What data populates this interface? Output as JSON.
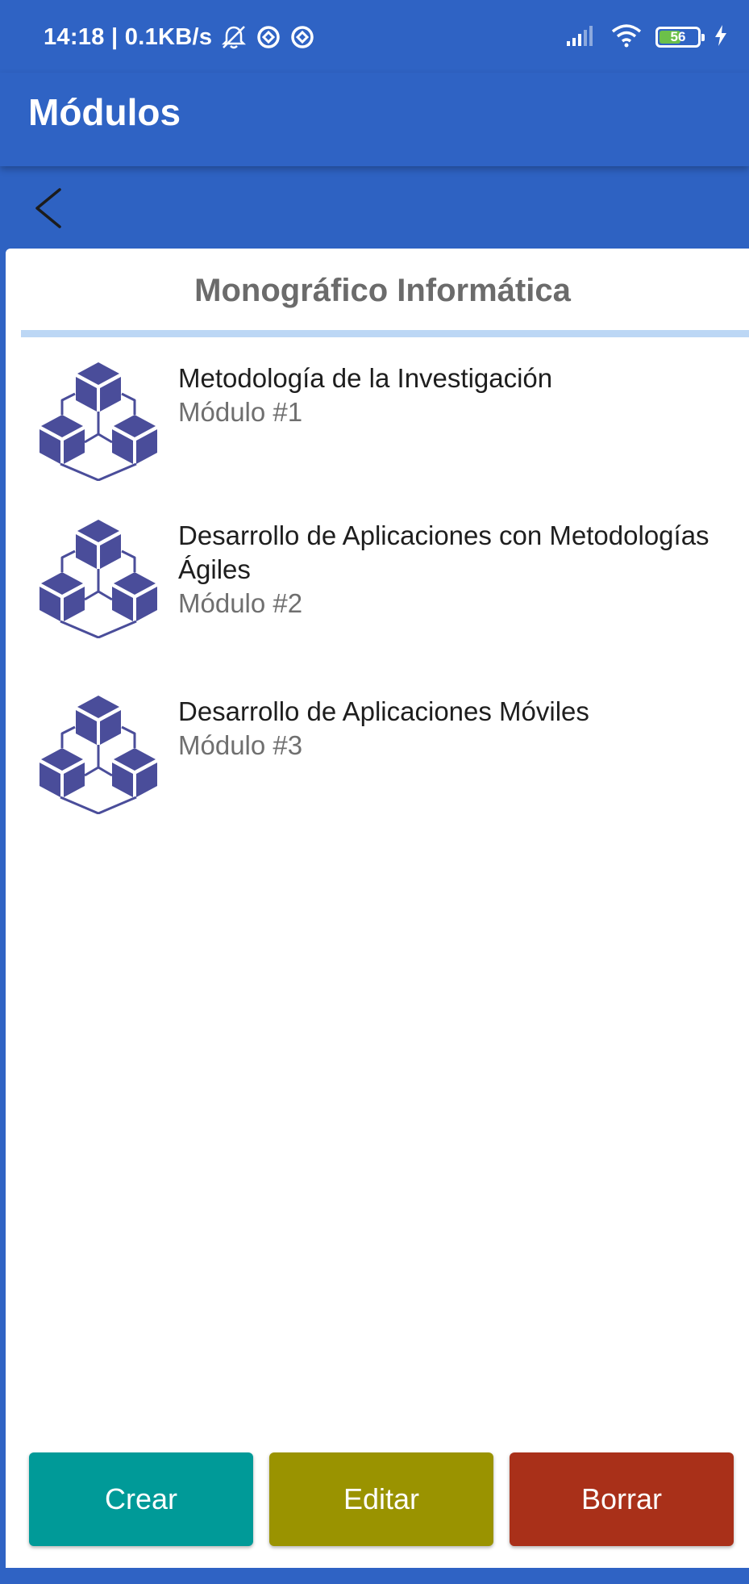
{
  "status_bar": {
    "time_and_speed": "14:18 | 0.1KB/s",
    "left_icons": [
      "alarm-off-icon",
      "sync-icon",
      "sync-icon"
    ],
    "right_icons": [
      "signal-icon",
      "wifi-icon",
      "battery-icon",
      "charging-icon"
    ],
    "battery_level": "56",
    "battery_fraction": 0.56
  },
  "app_bar": {
    "title": "Módulos"
  },
  "navigation": {
    "back_icon": "chevron-left-icon"
  },
  "course": {
    "title": "Monográfico Informática"
  },
  "modules": [
    {
      "name": "Metodología de la Investigación",
      "number": "Módulo #1",
      "icon": "modules-cube-icon"
    },
    {
      "name": "Desarrollo de Aplicaciones con Metodologías Ágiles",
      "number": "Módulo #2",
      "icon": "modules-cube-icon"
    },
    {
      "name": "Desarrollo de Aplicaciones Móviles",
      "number": "Módulo #3",
      "icon": "modules-cube-icon"
    }
  ],
  "actions": {
    "create_label": "Crear",
    "edit_label": "Editar",
    "delete_label": "Borrar"
  },
  "colors": {
    "primary": "#2f63c4",
    "divider": "#bcd7f5",
    "icon": "#4a4d9a",
    "create": "#009a98",
    "edit": "#9a9300",
    "delete": "#a93019"
  }
}
